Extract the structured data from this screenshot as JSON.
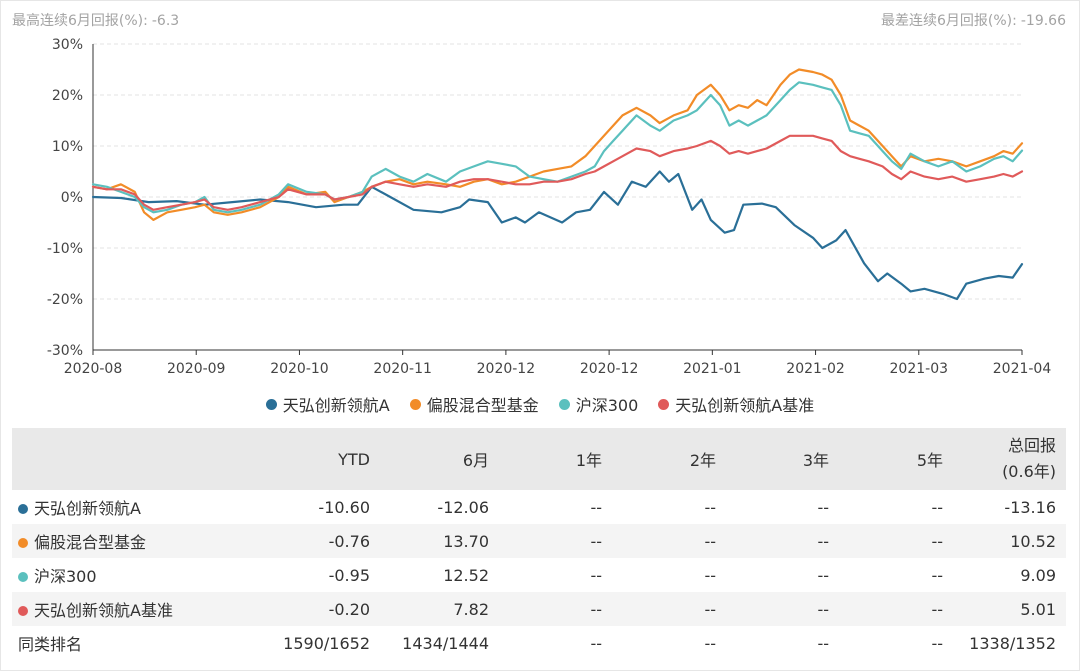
{
  "stats": {
    "max_label": "最高连续6月回报(%):",
    "max_value": "-6.3",
    "min_label": "最差连续6月回报(%):",
    "min_value": "-19.66"
  },
  "colors": {
    "fund": "#2a6f97",
    "category": "#f28c28",
    "hs300": "#5bc0be",
    "benchmark": "#e05a5a"
  },
  "chart_data": {
    "type": "line",
    "ylim": [
      -30,
      30
    ],
    "yticks": [
      30,
      20,
      10,
      0,
      -10,
      -20,
      -30
    ],
    "ytick_labels": [
      "30%",
      "20%",
      "10%",
      "0%",
      "-10%",
      "-20%",
      "-30%"
    ],
    "xlim": [
      0,
      9
    ],
    "xtick_labels": [
      "2020-08",
      "2020-09",
      "2020-10",
      "2020-11",
      "2020-12",
      "2020-12",
      "2021-01",
      "2021-02",
      "2021-03",
      "2021-04"
    ],
    "grid": true,
    "legend_position": "bottom",
    "series": [
      {
        "name": "天弘创新领航A",
        "color_key": "fund",
        "points": [
          [
            0,
            0
          ],
          [
            0.3,
            -0.2
          ],
          [
            0.6,
            -1
          ],
          [
            0.9,
            -0.8
          ],
          [
            1.2,
            -1.5
          ],
          [
            1.5,
            -1
          ],
          [
            1.8,
            -0.5
          ],
          [
            2.1,
            -1
          ],
          [
            2.4,
            -2
          ],
          [
            2.7,
            -1.5
          ],
          [
            2.85,
            -1.5
          ],
          [
            3.0,
            2
          ],
          [
            3.2,
            0
          ],
          [
            3.45,
            -2.5
          ],
          [
            3.75,
            -3
          ],
          [
            3.95,
            -2
          ],
          [
            4.05,
            -0.5
          ],
          [
            4.25,
            -1
          ],
          [
            4.4,
            -5
          ],
          [
            4.55,
            -4
          ],
          [
            4.65,
            -5
          ],
          [
            4.8,
            -3
          ],
          [
            5.05,
            -5
          ],
          [
            5.2,
            -3
          ],
          [
            5.35,
            -2.5
          ],
          [
            5.5,
            1
          ],
          [
            5.65,
            -1.5
          ],
          [
            5.8,
            3
          ],
          [
            5.95,
            2
          ],
          [
            6.1,
            5
          ],
          [
            6.2,
            3
          ],
          [
            6.3,
            4.5
          ],
          [
            6.45,
            -2.5
          ],
          [
            6.55,
            -0.5
          ],
          [
            6.65,
            -4.5
          ],
          [
            6.8,
            -7
          ],
          [
            6.9,
            -6.5
          ],
          [
            7.0,
            -1.5
          ],
          [
            7.2,
            -1.3
          ],
          [
            7.35,
            -2
          ],
          [
            7.55,
            -5.5
          ],
          [
            7.75,
            -8
          ],
          [
            7.85,
            -10
          ],
          [
            8.0,
            -8.5
          ],
          [
            8.1,
            -6.5
          ],
          [
            8.3,
            -13
          ],
          [
            8.45,
            -16.5
          ],
          [
            8.55,
            -15
          ],
          [
            8.7,
            -17
          ],
          [
            8.8,
            -18.5
          ],
          [
            8.95,
            -18
          ],
          [
            9.15,
            -19
          ],
          [
            9.3,
            -20
          ],
          [
            9.4,
            -17
          ],
          [
            9.6,
            -16
          ],
          [
            9.75,
            -15.5
          ],
          [
            9.9,
            -15.8
          ],
          [
            10.0,
            -13.16
          ]
        ]
      },
      {
        "name": "偏股混合型基金",
        "color_key": "category",
        "points": [
          [
            0,
            2
          ],
          [
            0.15,
            1.5
          ],
          [
            0.3,
            2.5
          ],
          [
            0.45,
            1
          ],
          [
            0.55,
            -3
          ],
          [
            0.65,
            -4.5
          ],
          [
            0.8,
            -3
          ],
          [
            0.95,
            -2.5
          ],
          [
            1.1,
            -2
          ],
          [
            1.2,
            -1.5
          ],
          [
            1.3,
            -3
          ],
          [
            1.45,
            -3.5
          ],
          [
            1.6,
            -3
          ],
          [
            1.8,
            -2
          ],
          [
            2.0,
            0
          ],
          [
            2.1,
            2
          ],
          [
            2.3,
            0.5
          ],
          [
            2.5,
            1
          ],
          [
            2.6,
            -1
          ],
          [
            2.75,
            0
          ],
          [
            2.9,
            1
          ],
          [
            3.0,
            2
          ],
          [
            3.15,
            3
          ],
          [
            3.3,
            3.5
          ],
          [
            3.45,
            2.5
          ],
          [
            3.6,
            3
          ],
          [
            3.8,
            2.5
          ],
          [
            3.95,
            2
          ],
          [
            4.1,
            3
          ],
          [
            4.25,
            3.5
          ],
          [
            4.4,
            2.5
          ],
          [
            4.55,
            3
          ],
          [
            4.7,
            4
          ],
          [
            4.85,
            5
          ],
          [
            5.0,
            5.5
          ],
          [
            5.15,
            6
          ],
          [
            5.3,
            8
          ],
          [
            5.4,
            10
          ],
          [
            5.5,
            12
          ],
          [
            5.6,
            14
          ],
          [
            5.7,
            16
          ],
          [
            5.85,
            17.5
          ],
          [
            6.0,
            16
          ],
          [
            6.1,
            14.5
          ],
          [
            6.25,
            16
          ],
          [
            6.4,
            17
          ],
          [
            6.5,
            20
          ],
          [
            6.65,
            22
          ],
          [
            6.75,
            20
          ],
          [
            6.85,
            17
          ],
          [
            6.95,
            18
          ],
          [
            7.05,
            17.5
          ],
          [
            7.15,
            19
          ],
          [
            7.25,
            18
          ],
          [
            7.4,
            22
          ],
          [
            7.5,
            24
          ],
          [
            7.6,
            25
          ],
          [
            7.75,
            24.5
          ],
          [
            7.85,
            24
          ],
          [
            7.95,
            23
          ],
          [
            8.05,
            20
          ],
          [
            8.15,
            15
          ],
          [
            8.25,
            14
          ],
          [
            8.35,
            13
          ],
          [
            8.5,
            10
          ],
          [
            8.6,
            8
          ],
          [
            8.7,
            6
          ],
          [
            8.8,
            8
          ],
          [
            8.95,
            7
          ],
          [
            9.1,
            7.5
          ],
          [
            9.25,
            7
          ],
          [
            9.4,
            6
          ],
          [
            9.55,
            7
          ],
          [
            9.7,
            8
          ],
          [
            9.8,
            9
          ],
          [
            9.9,
            8.5
          ],
          [
            10.0,
            10.52
          ]
        ]
      },
      {
        "name": "沪深300",
        "color_key": "hs300",
        "points": [
          [
            0,
            2.5
          ],
          [
            0.15,
            2
          ],
          [
            0.3,
            1
          ],
          [
            0.45,
            0
          ],
          [
            0.55,
            -2
          ],
          [
            0.65,
            -3
          ],
          [
            0.8,
            -2.5
          ],
          [
            0.95,
            -1.5
          ],
          [
            1.1,
            -1
          ],
          [
            1.2,
            0
          ],
          [
            1.3,
            -2.5
          ],
          [
            1.45,
            -3
          ],
          [
            1.6,
            -2.5
          ],
          [
            1.8,
            -1.5
          ],
          [
            2.0,
            0.5
          ],
          [
            2.1,
            2.5
          ],
          [
            2.3,
            1
          ],
          [
            2.5,
            0.5
          ],
          [
            2.6,
            -0.5
          ],
          [
            2.75,
            0
          ],
          [
            2.9,
            1
          ],
          [
            3.0,
            4
          ],
          [
            3.15,
            5.5
          ],
          [
            3.3,
            4
          ],
          [
            3.45,
            3
          ],
          [
            3.6,
            4.5
          ],
          [
            3.8,
            3
          ],
          [
            3.95,
            5
          ],
          [
            4.1,
            6
          ],
          [
            4.25,
            7
          ],
          [
            4.4,
            6.5
          ],
          [
            4.55,
            6
          ],
          [
            4.7,
            4
          ],
          [
            4.85,
            3.5
          ],
          [
            5.0,
            3
          ],
          [
            5.15,
            4
          ],
          [
            5.3,
            5
          ],
          [
            5.4,
            6
          ],
          [
            5.5,
            9
          ],
          [
            5.6,
            11
          ],
          [
            5.7,
            13
          ],
          [
            5.85,
            16
          ],
          [
            6.0,
            14
          ],
          [
            6.1,
            13
          ],
          [
            6.25,
            15
          ],
          [
            6.4,
            16
          ],
          [
            6.5,
            17
          ],
          [
            6.65,
            20
          ],
          [
            6.75,
            18
          ],
          [
            6.85,
            14
          ],
          [
            6.95,
            15
          ],
          [
            7.05,
            14
          ],
          [
            7.15,
            15
          ],
          [
            7.25,
            16
          ],
          [
            7.4,
            19
          ],
          [
            7.5,
            21
          ],
          [
            7.6,
            22.5
          ],
          [
            7.75,
            22
          ],
          [
            7.85,
            21.5
          ],
          [
            7.95,
            21
          ],
          [
            8.05,
            18
          ],
          [
            8.15,
            13
          ],
          [
            8.25,
            12.5
          ],
          [
            8.35,
            12
          ],
          [
            8.5,
            9
          ],
          [
            8.6,
            7
          ],
          [
            8.7,
            5.5
          ],
          [
            8.8,
            8.5
          ],
          [
            8.95,
            7
          ],
          [
            9.1,
            6
          ],
          [
            9.25,
            7
          ],
          [
            9.4,
            5
          ],
          [
            9.55,
            6
          ],
          [
            9.7,
            7.5
          ],
          [
            9.8,
            8
          ],
          [
            9.9,
            7
          ],
          [
            10.0,
            9.09
          ]
        ]
      },
      {
        "name": "天弘创新领航A基准",
        "color_key": "benchmark",
        "points": [
          [
            0,
            2
          ],
          [
            0.15,
            1.5
          ],
          [
            0.3,
            1.5
          ],
          [
            0.45,
            0.5
          ],
          [
            0.55,
            -1.5
          ],
          [
            0.65,
            -2.5
          ],
          [
            0.8,
            -2
          ],
          [
            0.95,
            -1.5
          ],
          [
            1.1,
            -1
          ],
          [
            1.2,
            -0.5
          ],
          [
            1.3,
            -2
          ],
          [
            1.45,
            -2.5
          ],
          [
            1.6,
            -2
          ],
          [
            1.8,
            -1
          ],
          [
            2.0,
            0
          ],
          [
            2.1,
            1.5
          ],
          [
            2.3,
            0.5
          ],
          [
            2.5,
            0.5
          ],
          [
            2.6,
            -0.5
          ],
          [
            2.75,
            0
          ],
          [
            2.9,
            0.5
          ],
          [
            3.0,
            2
          ],
          [
            3.15,
            3
          ],
          [
            3.3,
            2.5
          ],
          [
            3.45,
            2
          ],
          [
            3.6,
            2.5
          ],
          [
            3.8,
            2
          ],
          [
            3.95,
            3
          ],
          [
            4.1,
            3.5
          ],
          [
            4.25,
            3.5
          ],
          [
            4.4,
            3
          ],
          [
            4.55,
            2.5
          ],
          [
            4.7,
            2.5
          ],
          [
            4.85,
            3
          ],
          [
            5.0,
            3
          ],
          [
            5.15,
            3.5
          ],
          [
            5.3,
            4.5
          ],
          [
            5.4,
            5
          ],
          [
            5.5,
            6
          ],
          [
            5.6,
            7
          ],
          [
            5.7,
            8
          ],
          [
            5.85,
            9.5
          ],
          [
            6.0,
            9
          ],
          [
            6.1,
            8
          ],
          [
            6.25,
            9
          ],
          [
            6.4,
            9.5
          ],
          [
            6.5,
            10
          ],
          [
            6.65,
            11
          ],
          [
            6.75,
            10
          ],
          [
            6.85,
            8.5
          ],
          [
            6.95,
            9
          ],
          [
            7.05,
            8.5
          ],
          [
            7.15,
            9
          ],
          [
            7.25,
            9.5
          ],
          [
            7.4,
            11
          ],
          [
            7.5,
            12
          ],
          [
            7.6,
            12
          ],
          [
            7.75,
            12
          ],
          [
            7.85,
            11.5
          ],
          [
            7.95,
            11
          ],
          [
            8.05,
            9
          ],
          [
            8.15,
            8
          ],
          [
            8.25,
            7.5
          ],
          [
            8.35,
            7
          ],
          [
            8.5,
            6
          ],
          [
            8.6,
            4.5
          ],
          [
            8.7,
            3.5
          ],
          [
            8.8,
            5
          ],
          [
            8.95,
            4
          ],
          [
            9.1,
            3.5
          ],
          [
            9.25,
            4
          ],
          [
            9.4,
            3
          ],
          [
            9.55,
            3.5
          ],
          [
            9.7,
            4
          ],
          [
            9.8,
            4.5
          ],
          [
            9.9,
            4
          ],
          [
            10.0,
            5.01
          ]
        ]
      }
    ]
  },
  "table": {
    "headers": [
      "",
      "YTD",
      "6月",
      "1年",
      "2年",
      "3年",
      "5年",
      "总回报",
      "(0.6年)"
    ],
    "rows": [
      {
        "name": "天弘创新领航A",
        "color_key": "fund",
        "values": [
          "-10.60",
          "-12.06",
          "--",
          "--",
          "--",
          "--",
          "-13.16"
        ]
      },
      {
        "name": "偏股混合型基金",
        "color_key": "category",
        "values": [
          "-0.76",
          "13.70",
          "--",
          "--",
          "--",
          "--",
          "10.52"
        ]
      },
      {
        "name": "沪深300",
        "color_key": "hs300",
        "values": [
          "-0.95",
          "12.52",
          "--",
          "--",
          "--",
          "--",
          "9.09"
        ]
      },
      {
        "name": "天弘创新领航A基准",
        "color_key": "benchmark",
        "values": [
          "-0.20",
          "7.82",
          "--",
          "--",
          "--",
          "--",
          "5.01"
        ]
      },
      {
        "name": "同类排名",
        "color_key": null,
        "values": [
          "1590/1652",
          "1434/1444",
          "--",
          "--",
          "--",
          "--",
          "1338/1352"
        ]
      }
    ]
  }
}
